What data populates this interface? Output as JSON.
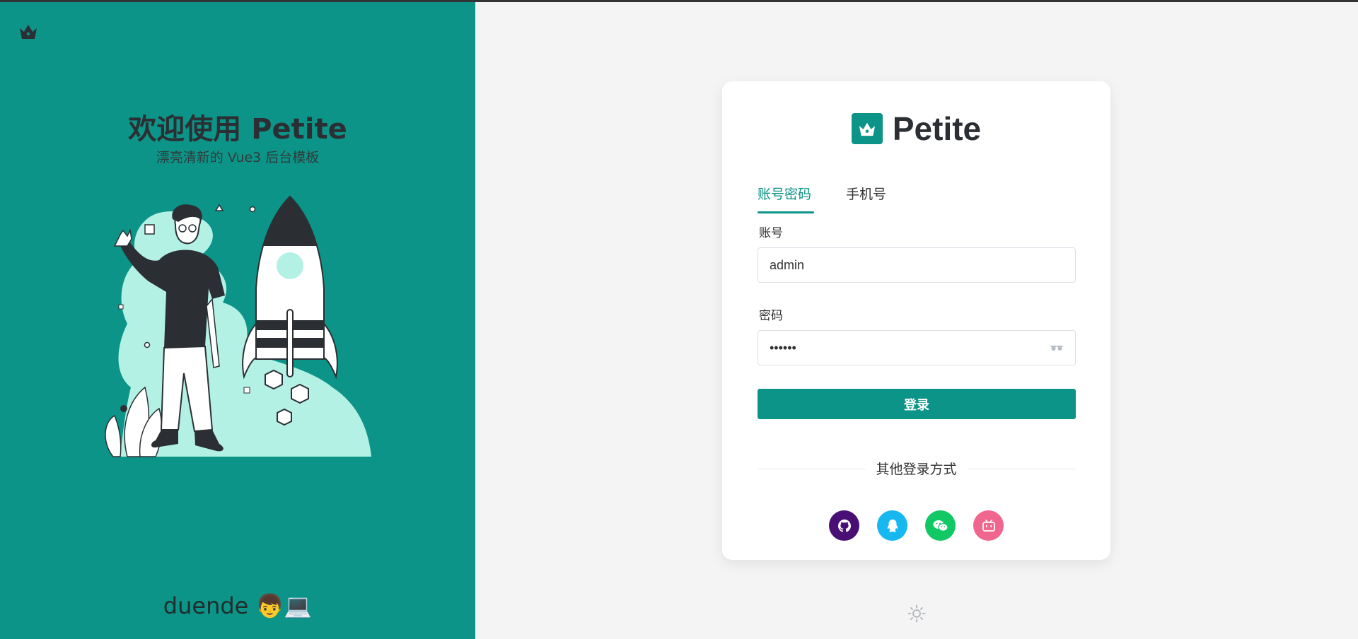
{
  "left": {
    "welcome_title": "欢迎使用 Petite",
    "subtitle": "漂亮清新的 Vue3 后台模板",
    "author": "duende 👦💻",
    "logo_icon": "crown-icon"
  },
  "card": {
    "brand_name": "Petite",
    "brand_icon": "crown-icon",
    "tabs": [
      {
        "label": "账号密码",
        "active": true
      },
      {
        "label": "手机号",
        "active": false
      }
    ],
    "account": {
      "label": "账号",
      "value": "admin"
    },
    "password": {
      "label": "密码",
      "value": "••••••",
      "toggle_icon": "eye-icon"
    },
    "login_button": "登录",
    "other_login": "其他登录方式",
    "social_logins": [
      {
        "name": "github-icon",
        "color": "#4a0f74"
      },
      {
        "name": "qq-icon",
        "color": "#17b7f0"
      },
      {
        "name": "wechat-icon",
        "color": "#11c865"
      },
      {
        "name": "bilibili-icon",
        "color": "#f0668f"
      }
    ]
  },
  "theme_toggle_icon": "sun-icon",
  "colors": {
    "accent": "#0d9488",
    "page_bg": "#f4f4f4",
    "illustration_mint": "#b4f1e5"
  }
}
